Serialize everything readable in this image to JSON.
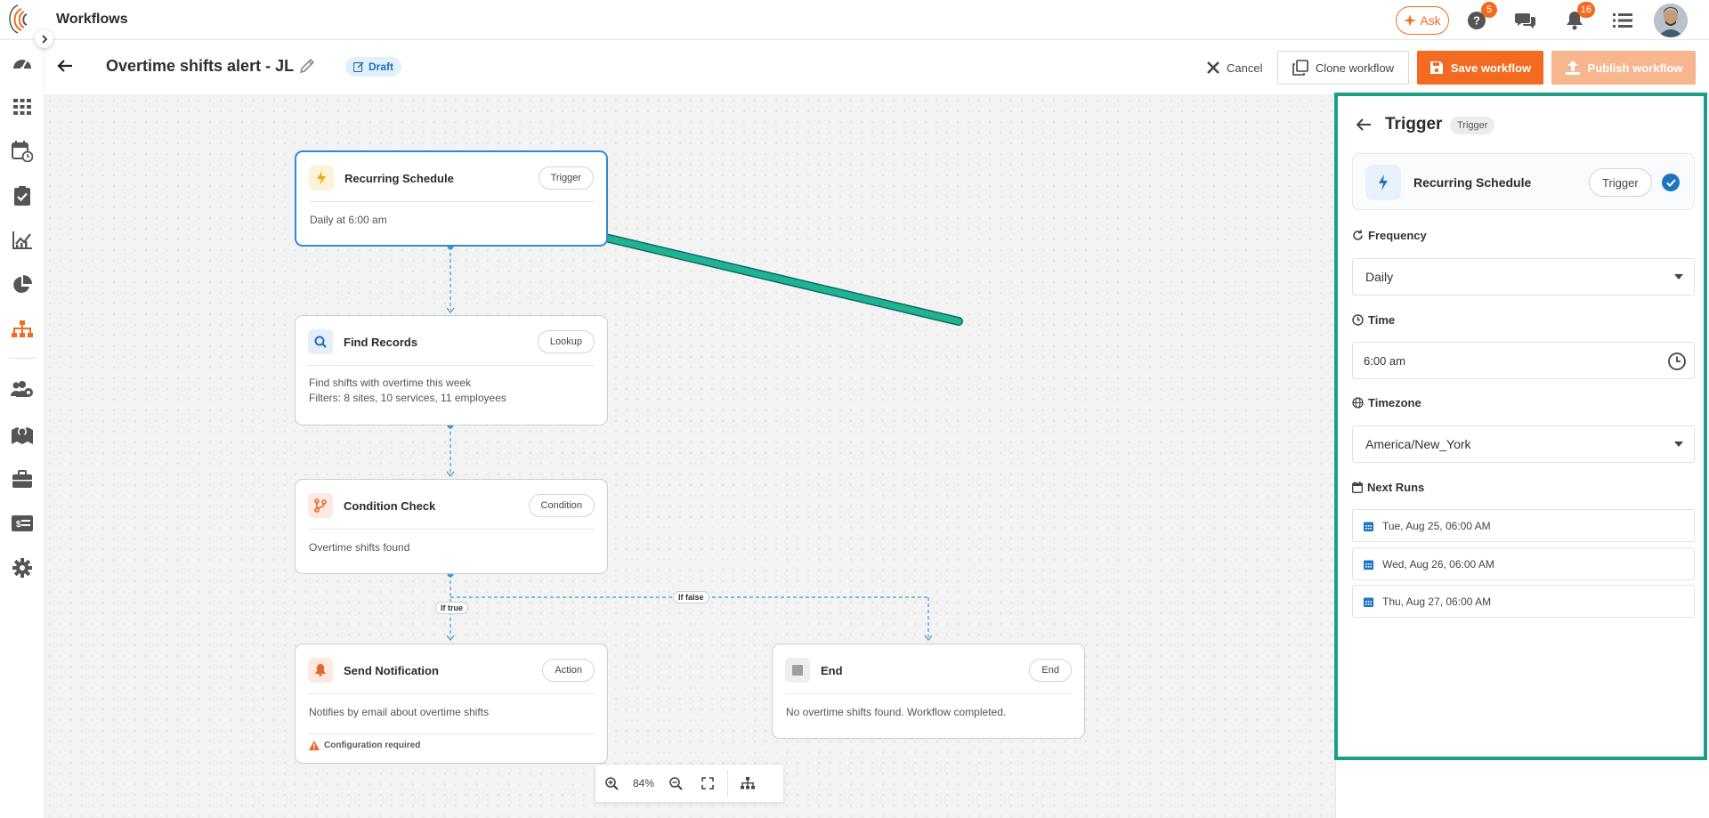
{
  "app": {
    "title": "Workflows"
  },
  "topbar": {
    "ask_label": "Ask",
    "help_badge": "5",
    "notification_badge": "16"
  },
  "workflow": {
    "title": "Overtime shifts alert - JL",
    "status": "Draft"
  },
  "actions": {
    "cancel": "Cancel",
    "clone": "Clone workflow",
    "save": "Save workflow",
    "publish": "Publish workflow"
  },
  "nodes": [
    {
      "title": "Recurring Schedule",
      "type": "Trigger",
      "body": [
        "Daily at 6:00 am"
      ],
      "icon": "bolt-icon"
    },
    {
      "title": "Find Records",
      "type": "Lookup",
      "body": [
        "Find shifts with overtime this week",
        "Filters: 8 sites, 10 services, 11 employees"
      ],
      "icon": "search-icon"
    },
    {
      "title": "Condition Check",
      "type": "Condition",
      "body": [
        "Overtime shifts found"
      ],
      "icon": "branch-icon"
    },
    {
      "title": "Send Notification",
      "type": "Action",
      "body": [
        "Notifies by email about overtime shifts"
      ],
      "warning": "Configuration required",
      "icon": "bell-icon"
    },
    {
      "title": "End",
      "type": "End",
      "body": [
        "No overtime shifts found. Workflow completed."
      ],
      "icon": "stop-icon"
    }
  ],
  "edges": {
    "if_true": "If true",
    "if_false": "If false"
  },
  "zoom": {
    "level": "84%"
  },
  "panel": {
    "title": "Trigger",
    "badge": "Trigger",
    "card_title": "Recurring Schedule",
    "card_type": "Trigger",
    "frequency_label": "Frequency",
    "frequency_value": "Daily",
    "time_label": "Time",
    "time_value": "6:00 am",
    "timezone_label": "Timezone",
    "timezone_value": "America/New_York",
    "next_runs_label": "Next Runs",
    "next_runs": [
      "Tue, Aug 25, 06:00 AM",
      "Wed, Aug 26, 06:00 AM",
      "Thu, Aug 27, 06:00 AM"
    ]
  },
  "colors": {
    "accent": "#f26b21",
    "primary": "#2f8ad8",
    "annotation": "#1a9f86"
  }
}
